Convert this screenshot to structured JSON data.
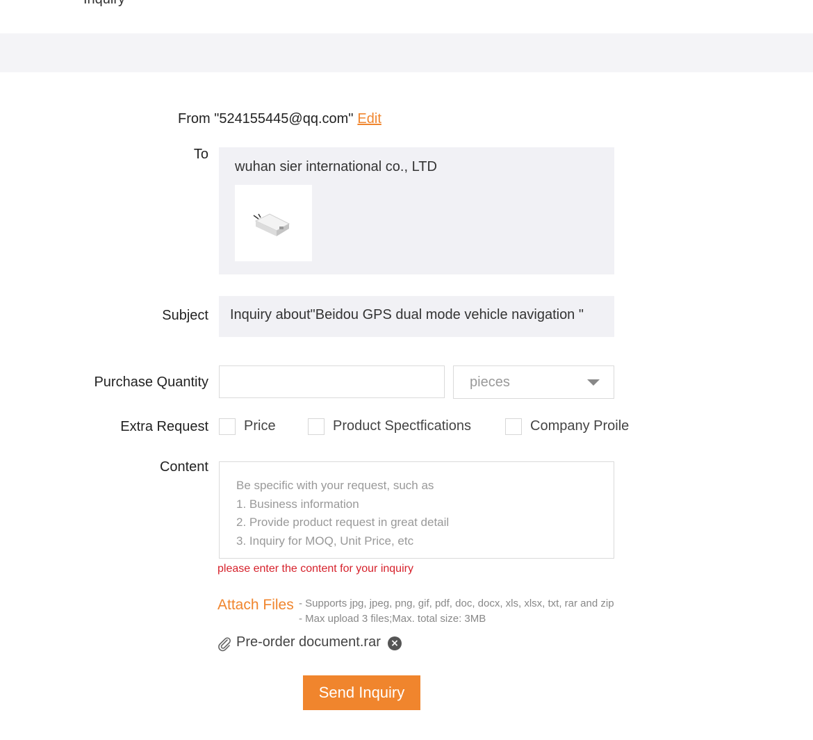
{
  "header": {
    "title": "Inquiry"
  },
  "form": {
    "from_prefix": "From \"524155445@qq.com\"",
    "edit_label": "Edit",
    "to_label": "To",
    "to_company": "wuhan sier international co., LTD",
    "subject_label": "Subject",
    "subject_value": "Inquiry about\"Beidou GPS dual mode  vehicle navigation \"",
    "quantity_label": "Purchase Quantity",
    "quantity_value": "",
    "unit_selected": "pieces",
    "extra_label": "Extra Request",
    "extra_options": [
      {
        "label": "Price",
        "checked": false
      },
      {
        "label": "Product Spectfications",
        "checked": false
      },
      {
        "label": "Company Proile",
        "checked": false
      }
    ],
    "content_label": "Content",
    "content_placeholder_lines": [
      "Be specific with your request, such as",
      "1. Business information",
      "2. Provide product request in great detail",
      "3. Inquiry for MOQ, Unit Price, etc"
    ],
    "error_message": "please enter the content for your inquiry",
    "attach_label": "Attach Files",
    "attach_hints": [
      "- Supports jpg, jpeg, png, gif, pdf, doc, docx, xls, xlsx, txt, rar and zip",
      "- Max upload 3 files;Max. total size: 3MB"
    ],
    "attached_file": "Pre-order document.rar",
    "send_label": "Send Inquiry"
  },
  "colors": {
    "accent": "#f0852d",
    "error": "#d6212b",
    "panel": "#f1f1f5"
  },
  "icons": {
    "attachment": "paperclip-icon",
    "remove": "close-circle-icon",
    "dropdown": "caret-down-icon"
  }
}
